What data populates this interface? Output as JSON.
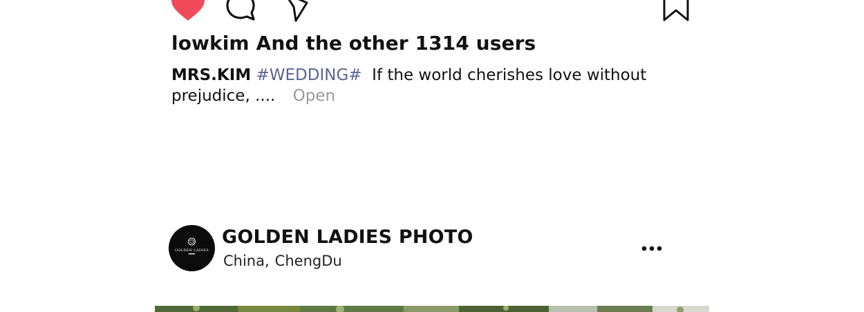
{
  "actions": {
    "like_icon": "heart-icon",
    "comment_icon": "comment-icon",
    "share_icon": "share-icon",
    "save_icon": "bookmark-icon",
    "like_color": "#f04a5a"
  },
  "likes": {
    "text": "lowkim And the other 1314 users"
  },
  "caption": {
    "author": "MRS.KIM",
    "hashtag": "#WEDDING#",
    "text": "If the world cherishes love without prejudice, ....",
    "open_label": "Open"
  },
  "post": {
    "account_name": "GOLDEN LADIES PHOTO",
    "avatar_text": "GOLDEN LADIES",
    "location_country": "China,",
    "location_city": "ChengDu",
    "more_icon": "more-icon"
  }
}
